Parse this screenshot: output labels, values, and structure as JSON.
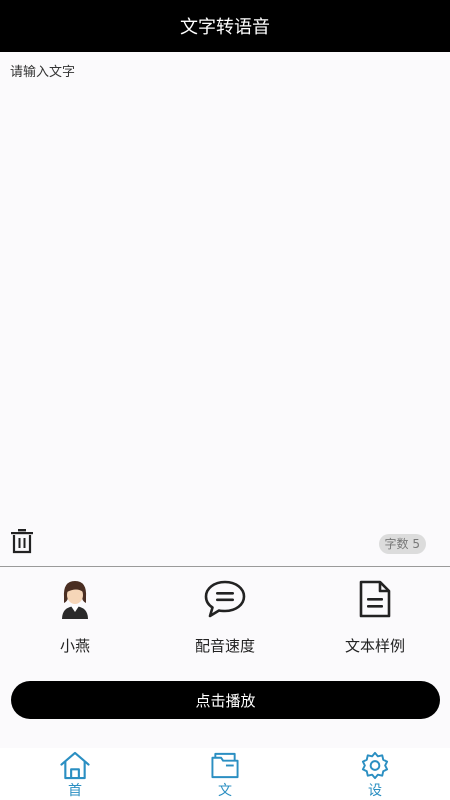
{
  "header": {
    "title": "文字转语音"
  },
  "editor": {
    "placeholder": "请输入文字",
    "count_label": "字数 5"
  },
  "options": [
    {
      "label": "小燕",
      "icon": "female-avatar-icon"
    },
    {
      "label": "配音速度",
      "icon": "speech-bubble-icon"
    },
    {
      "label": "文本样例",
      "icon": "document-icon"
    }
  ],
  "play_button": {
    "label": "点击播放"
  },
  "tabbar": {
    "items": [
      {
        "label": "首",
        "icon": "home-icon"
      },
      {
        "label": "文",
        "icon": "folder-icon"
      },
      {
        "label": "设",
        "icon": "settings-icon"
      }
    ]
  },
  "colors": {
    "header_bg": "#000000",
    "accent": "#2b8fc2",
    "background": "#fbfafc"
  }
}
